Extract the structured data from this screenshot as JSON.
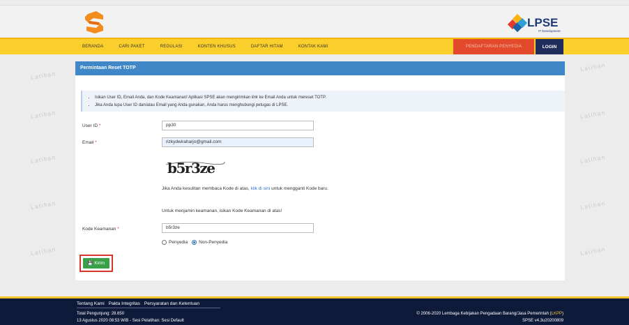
{
  "watermark": "Latihan",
  "nav": {
    "items": [
      "BERANDA",
      "CARI PAKET",
      "REGULASI",
      "KONTEN KHUSUS",
      "DAFTAR HITAM",
      "KONTAK KAMI"
    ],
    "register": "PENDAFTARAN PENYEDIA",
    "login": "LOGIN"
  },
  "brand": {
    "lpse": "LPSE",
    "subtitle": "IT Development"
  },
  "panel": {
    "title": "Permintaan Reset TOTP",
    "info": {
      "line1_pre": "Isikan User ID, Email Anda, dan Kode Keamanan! Aplikasi SPSE akan mengirimkan ",
      "line1_em": "link",
      "line1_post": " ke Email Anda untuk mereset TOTP.",
      "line2": "Jika Anda lupa User ID dan/atau Email yang Anda gunakan, Anda harus menghubungi petugas di LPSE."
    },
    "userid_label": "User ID",
    "userid_value": "pp30",
    "email_label": "Email",
    "email_value": "rizkydwiraharjo@gmail.com",
    "captcha_value": "b5r3ze",
    "captcha_help_pre": "Jika Anda kesulitan membaca Kode di atas, ",
    "captcha_help_link": "klik di sini",
    "captcha_help_post": " untuk mengganti Kode baru.",
    "security_note": "Untuk menjamin keamanan, isikan Kode Keamanan di atas!",
    "code_label": "Kode Keamanan",
    "code_value": "b5r3ze",
    "radio_penyedia": "Penyedia",
    "radio_nonpenyedia": "Non-Penyedia",
    "submit": "Kirim",
    "required_mark": "*"
  },
  "footer": {
    "links": [
      "Tentang Kami",
      "Pakta Integritas",
      "Persyaratan dan Ketentuan"
    ],
    "visitors": "Total Pengunjung: 28.650",
    "session": "13 Agustus 2020 08:53 WIB - Sesi Pelatihan: Sesi Default",
    "copyright_pre": "© 2006-2020 Lembaga Kebijakan Pengadaan Barang/Jasa Pemerintah (",
    "copyright_link": "LKPP",
    "copyright_post": ")",
    "version": "SPSE v4.3u20200809"
  },
  "colors": {
    "accent": "#fbcf2b",
    "header": "#3f87c6",
    "footer": "#0e1a3a",
    "submit": "#3ba148",
    "register": "#e24a2b"
  }
}
